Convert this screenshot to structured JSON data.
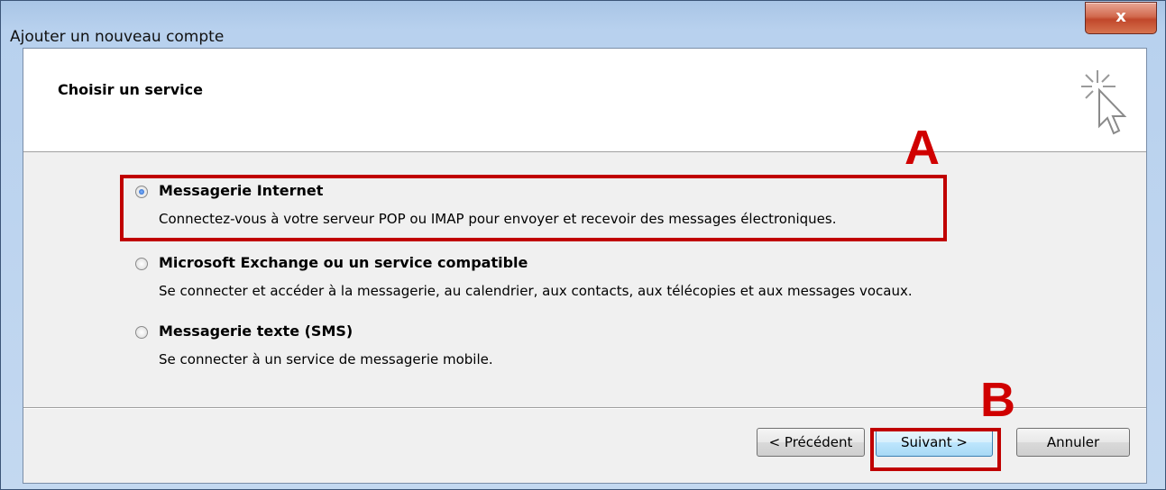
{
  "window": {
    "title": "Ajouter un nouveau compte",
    "close_label": "x"
  },
  "header": {
    "title": "Choisir un service",
    "icon": "wizard-cursor-icon"
  },
  "options": [
    {
      "label": "Messagerie Internet",
      "description": "Connectez-vous à votre serveur POP ou IMAP pour envoyer et recevoir des messages électroniques.",
      "selected": true
    },
    {
      "label": "Microsoft Exchange ou un service compatible",
      "description": "Se connecter et accéder à la messagerie, au calendrier, aux contacts, aux télécopies et aux messages vocaux.",
      "selected": false
    },
    {
      "label": "Messagerie texte (SMS)",
      "description": "Se connecter à un service de messagerie mobile.",
      "selected": false
    }
  ],
  "buttons": {
    "back": "< Précédent",
    "next": "Suivant >",
    "cancel": "Annuler"
  },
  "annotations": {
    "a": "A",
    "b": "B",
    "color": "#c00000"
  }
}
